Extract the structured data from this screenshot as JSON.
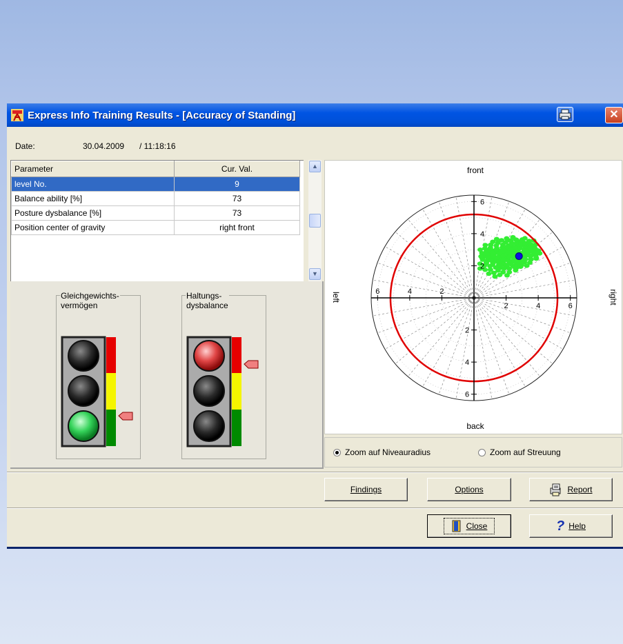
{
  "window": {
    "title": "Express Info Training Results - [Accuracy of Standing]",
    "icons": [
      "app-icon",
      "printer-icon",
      "close-icon"
    ]
  },
  "date": {
    "label": "Date:",
    "date": "30.04.2009",
    "time": "/ 11:18:16"
  },
  "table": {
    "headers": [
      "Parameter",
      "Cur. Val."
    ],
    "rows": [
      {
        "param": "level No.",
        "value": "9",
        "selected": true
      },
      {
        "param": "Balance ability [%]",
        "value": "73"
      },
      {
        "param": "Posture dysbalance [%]",
        "value": "73"
      },
      {
        "param": "Position center of gravity",
        "value": "right front"
      }
    ]
  },
  "traffic_lights": [
    {
      "caption": "Gleichgewichts-\nvermögen",
      "lit": "green",
      "indicator_level": "green"
    },
    {
      "caption": "Haltungs-\ndysbalance",
      "lit": "red",
      "indicator_level": "red"
    }
  ],
  "chart": {
    "labels": {
      "front": "front",
      "back": "back",
      "left": "left",
      "right": "right"
    },
    "ticks": [
      "2",
      "4",
      "6"
    ],
    "colors": {
      "circle": "#e00000",
      "cloud": "#33ee33",
      "center": "#1010e0"
    }
  },
  "zoom": {
    "options": [
      "Zoom auf Niveauradius",
      "Zoom auf Streuung"
    ],
    "selected": "Zoom auf Niveauradius"
  },
  "buttons": {
    "findings": "Findings",
    "options": "Options",
    "report": "Report",
    "close": "Close",
    "help": "Help"
  }
}
